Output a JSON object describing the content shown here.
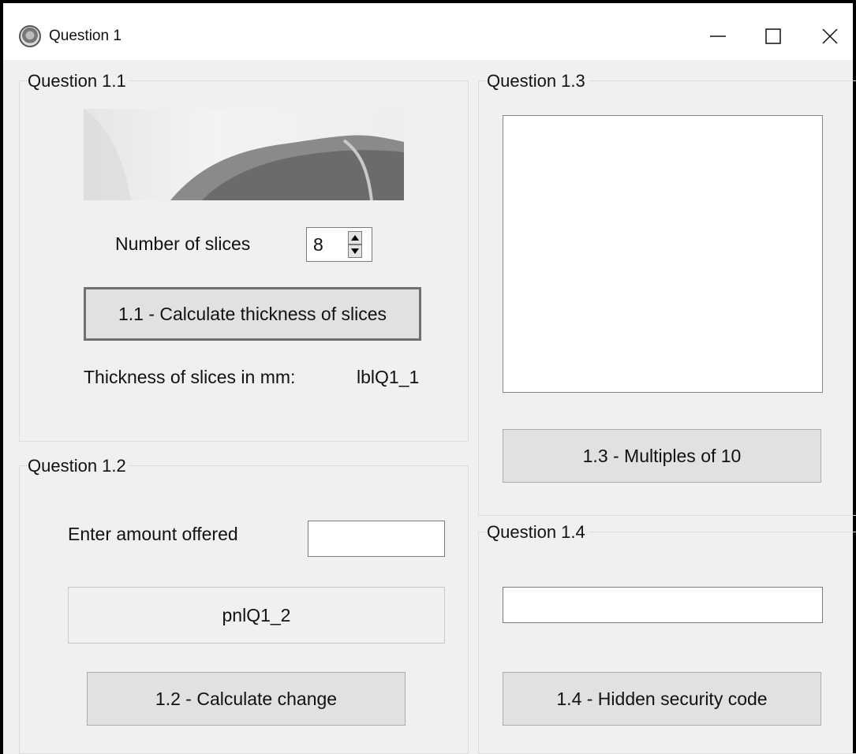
{
  "window": {
    "title": "Question 1"
  },
  "q1_1": {
    "group_title": "Question 1.1",
    "slices_label": "Number of slices",
    "slices_value": "8",
    "calc_button": "1.1 - Calculate thickness of slices",
    "thickness_label": "Thickness of slices in mm:",
    "thickness_value": "lblQ1_1"
  },
  "q1_2": {
    "group_title": "Question 1.2",
    "amount_label": "Enter amount offered",
    "amount_value": "",
    "panel_text": "pnlQ1_2",
    "calc_button": "1.2 - Calculate change"
  },
  "q1_3": {
    "group_title": "Question 1.3",
    "multiples_button": "1.3 - Multiples of 10"
  },
  "q1_4": {
    "group_title": "Question 1.4",
    "code_value": "",
    "code_button": "1.4 - Hidden security code"
  }
}
